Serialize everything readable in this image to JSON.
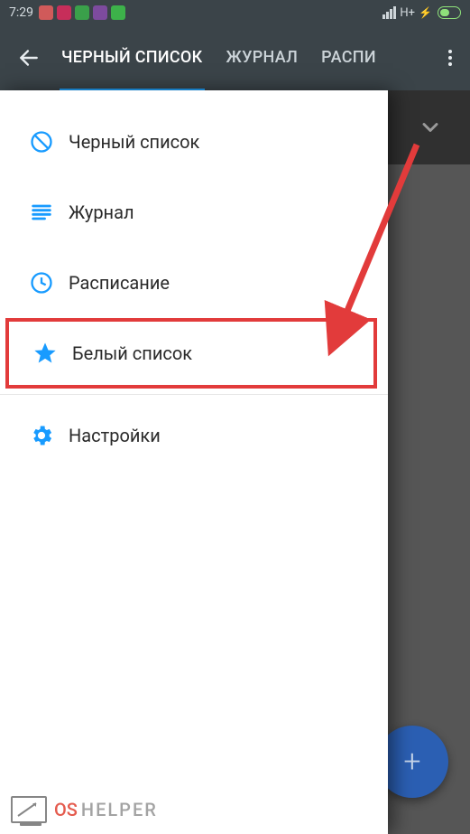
{
  "statusbar": {
    "time": "7:29",
    "network_label": "H+"
  },
  "appbar": {
    "tabs": {
      "blacklist": "ЧЕРНЫЙ СПИСОК",
      "journal": "ЖУРНАЛ",
      "schedule_short": "РАСПИ"
    }
  },
  "drawer": {
    "items": {
      "blacklist": "Черный список",
      "journal": "Журнал",
      "schedule": "Расписание",
      "whitelist": "Белый список",
      "settings": "Настройки"
    }
  },
  "watermark": {
    "os": "OS",
    "helper": "HELPER"
  }
}
